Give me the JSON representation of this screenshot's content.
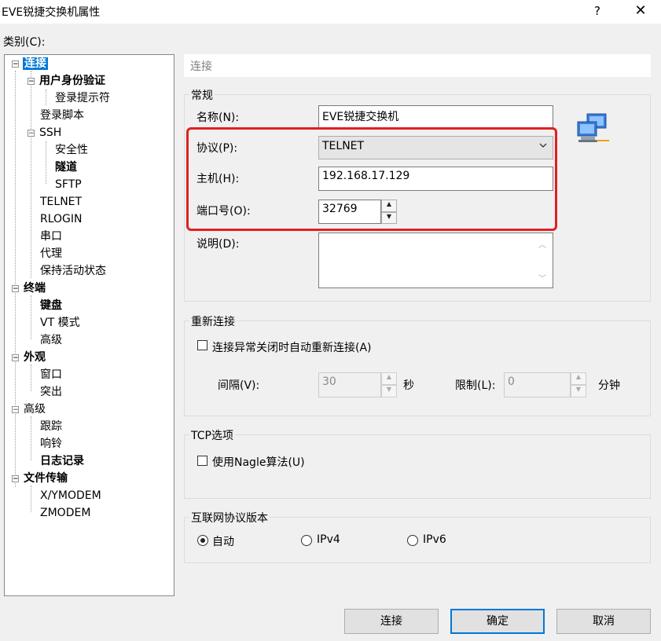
{
  "window": {
    "title": "EVE锐捷交换机属性",
    "help": "?",
    "close": "✕"
  },
  "category_label": "类别(C):",
  "tree": [
    {
      "label": "连接",
      "bold": true,
      "selected": true
    },
    {
      "label": "用户身份验证",
      "bold": true
    },
    {
      "label": "登录提示符"
    },
    {
      "label": "登录脚本"
    },
    {
      "label": "SSH"
    },
    {
      "label": "安全性"
    },
    {
      "label": "隧道",
      "bold": true
    },
    {
      "label": "SFTP"
    },
    {
      "label": "TELNET"
    },
    {
      "label": "RLOGIN"
    },
    {
      "label": "串口"
    },
    {
      "label": "代理"
    },
    {
      "label": "保持活动状态"
    },
    {
      "label": "终端",
      "bold": true
    },
    {
      "label": "键盘",
      "bold": true
    },
    {
      "label": "VT 模式"
    },
    {
      "label": "高级"
    },
    {
      "label": "外观",
      "bold": true
    },
    {
      "label": "窗口"
    },
    {
      "label": "突出"
    },
    {
      "label": "高级"
    },
    {
      "label": "跟踪"
    },
    {
      "label": "响铃"
    },
    {
      "label": "日志记录",
      "bold": true
    },
    {
      "label": "文件传输",
      "bold": true
    },
    {
      "label": "X/YMODEM"
    },
    {
      "label": "ZMODEM"
    }
  ],
  "header": "连接",
  "general": {
    "title": "常规",
    "name_label": "名称(N):",
    "name_value": "EVE锐捷交换机",
    "protocol_label": "协议(P):",
    "protocol_value": "TELNET",
    "host_label": "主机(H):",
    "host_value": "192.168.17.129",
    "port_label": "端口号(O):",
    "port_value": "32769",
    "desc_label": "说明(D):",
    "desc_value": ""
  },
  "reconnect": {
    "title": "重新连接",
    "auto_label": "连接异常关闭时自动重新连接(A)",
    "interval_label": "间隔(V):",
    "interval_value": "30",
    "sec_unit": "秒",
    "limit_label": "限制(L):",
    "limit_value": "0",
    "min_unit": "分钟"
  },
  "tcp": {
    "title": "TCP选项",
    "nagle_label": "使用Nagle算法(U)"
  },
  "ip": {
    "title": "互联网协议版本",
    "auto": "自动",
    "ipv4": "IPv4",
    "ipv6": "IPv6"
  },
  "buttons": {
    "connect": "连接",
    "ok": "确定",
    "cancel": "取消"
  },
  "colors": {
    "selection": "#0078d7",
    "highlight_box": "#e02020"
  }
}
